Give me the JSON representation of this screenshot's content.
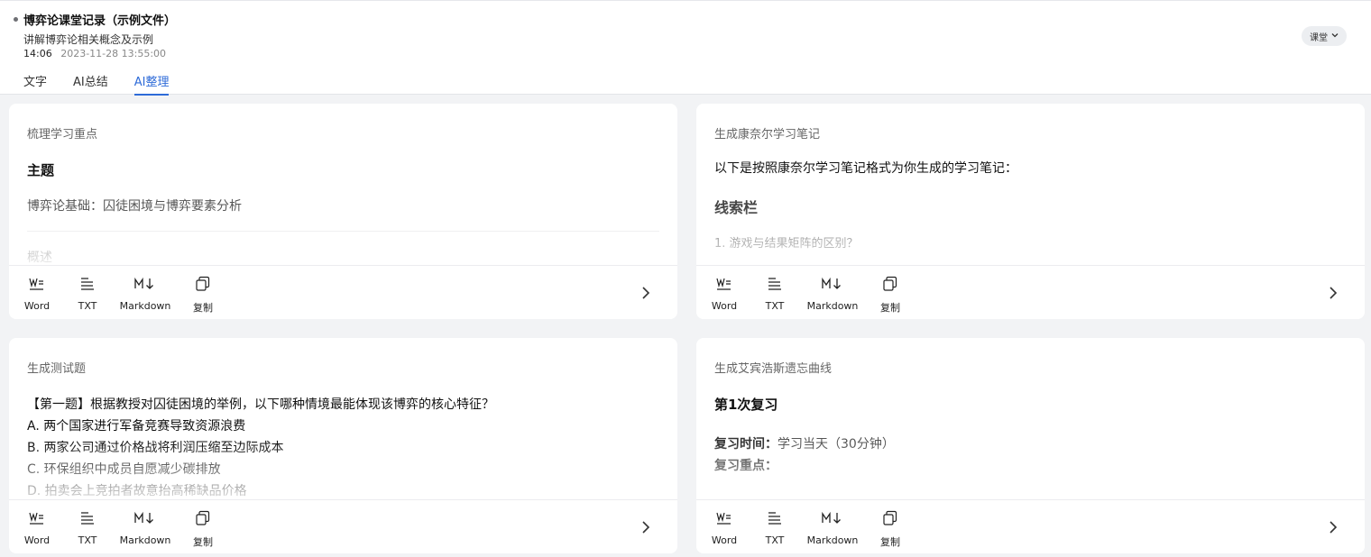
{
  "header": {
    "title": "博弈论课堂记录（示例文件）",
    "subtitle": "讲解博弈论相关概念及示例",
    "duration": "14:06",
    "datetime": "2023-11-28 13:55:00",
    "mode": "课堂",
    "tabs": [
      {
        "label": "文字",
        "active": false
      },
      {
        "label": "AI总结",
        "active": false
      },
      {
        "label": "AI整理",
        "active": true
      }
    ]
  },
  "toolbar": {
    "word": "Word",
    "txt": "TXT",
    "markdown": "Markdown",
    "copy": "复制",
    "icons": [
      "word-icon",
      "txt-icon",
      "markdown-icon",
      "copy-icon",
      "chevron-right-icon"
    ]
  },
  "cards": [
    {
      "title": "梳理学习重点",
      "heading": "主题",
      "body": "博弈论基础：囚徒困境与博弈要素分析",
      "section": "概述"
    },
    {
      "title": "生成康奈尔学习笔记",
      "intro": "以下是按照康奈尔学习笔记格式为你生成的学习笔记：",
      "heading": "线索栏",
      "item1": "1. 游戏与结果矩阵的区别？"
    },
    {
      "title": "生成测试题",
      "question": "【第一题】根据教授对囚徒困境的举例，以下哪种情境最能体现该博弈的核心特征？",
      "options": [
        "A. 两个国家进行军备竞赛导致资源浪费",
        "B. 两家公司通过价格战将利润压缩至边际成本",
        "C. 环保组织中成员自愿减少碳排放",
        "D. 拍卖会上竞拍者故意抬高稀缺品价格"
      ]
    },
    {
      "title": "生成艾宾浩斯遗忘曲线",
      "heading": "第1次复习",
      "time_label": "复习时间：",
      "time_value": "学习当天（30分钟）",
      "focus_label": "复习重点："
    }
  ],
  "colors": {
    "accent": "#2e6bd8",
    "background": "#f2f3f5",
    "card": "#ffffff"
  }
}
